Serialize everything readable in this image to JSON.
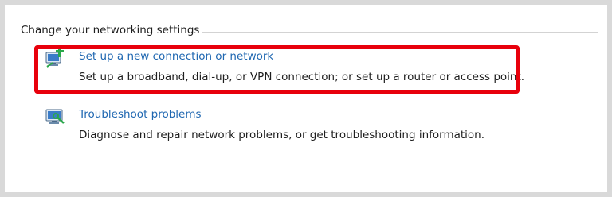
{
  "section": {
    "title": "Change your networking settings"
  },
  "items": [
    {
      "link": "Set up a new connection or network",
      "description": "Set up a broadband, dial-up, or VPN connection; or set up a router or access point.",
      "icon": "new-connection-icon"
    },
    {
      "link": "Troubleshoot problems",
      "description": "Diagnose and repair network problems, or get troubleshooting information.",
      "icon": "troubleshoot-icon"
    }
  ],
  "colors": {
    "link": "#1f67b1",
    "highlight": "#e8000c",
    "text": "#1e1e1e"
  }
}
